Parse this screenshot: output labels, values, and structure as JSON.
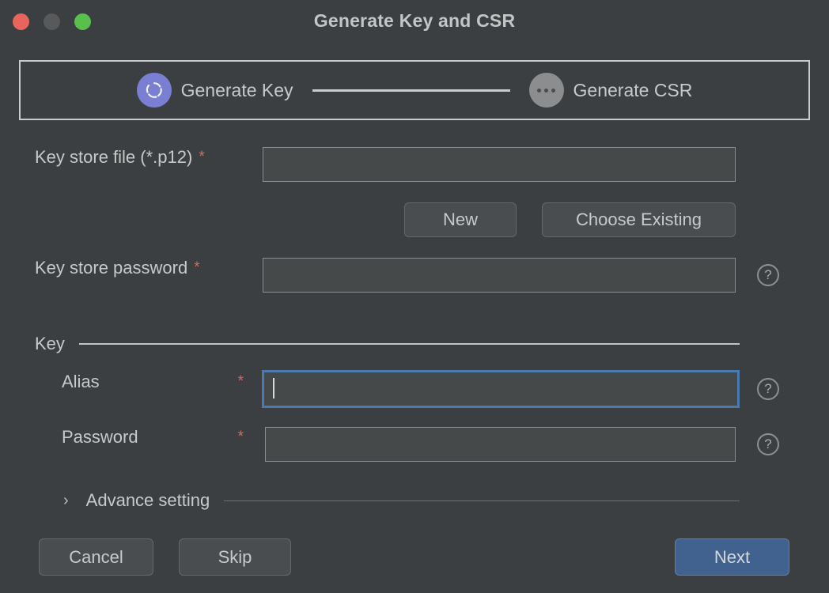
{
  "window": {
    "title": "Generate Key and CSR",
    "traffic_lights": [
      "close",
      "minimize",
      "zoom"
    ],
    "colors": {
      "background": "#3c3f41",
      "accent_active_step": "#7b7fd4",
      "primary_button": "#41618f",
      "focus_border": "#4a7ab0",
      "required_marker": "#d4695f"
    }
  },
  "stepper": {
    "steps": [
      {
        "label": "Generate Key",
        "state": "active",
        "icon": "spinner-circle-icon"
      },
      {
        "label": "Generate CSR",
        "state": "pending",
        "icon": "ellipsis-icon"
      }
    ]
  },
  "form": {
    "keystore_file": {
      "label": "Key store file (*.p12)",
      "required_marker": "*",
      "value": "",
      "placeholder": ""
    },
    "file_buttons": {
      "new_label": "New",
      "choose_existing_label": "Choose Existing"
    },
    "keystore_password": {
      "label": "Key store password",
      "required_marker": "*",
      "value": "",
      "placeholder": "",
      "help": "?"
    },
    "key_section": {
      "title": "Key",
      "alias": {
        "label": "Alias",
        "required_marker": "*",
        "value": "",
        "placeholder": "",
        "help": "?",
        "focused": true
      },
      "password": {
        "label": "Password",
        "required_marker": "*",
        "value": "",
        "placeholder": "",
        "help": "?"
      }
    },
    "advance_setting": {
      "label": "Advance setting",
      "expanded": false,
      "chevron": "›"
    }
  },
  "footer": {
    "cancel_label": "Cancel",
    "skip_label": "Skip",
    "next_label": "Next"
  }
}
